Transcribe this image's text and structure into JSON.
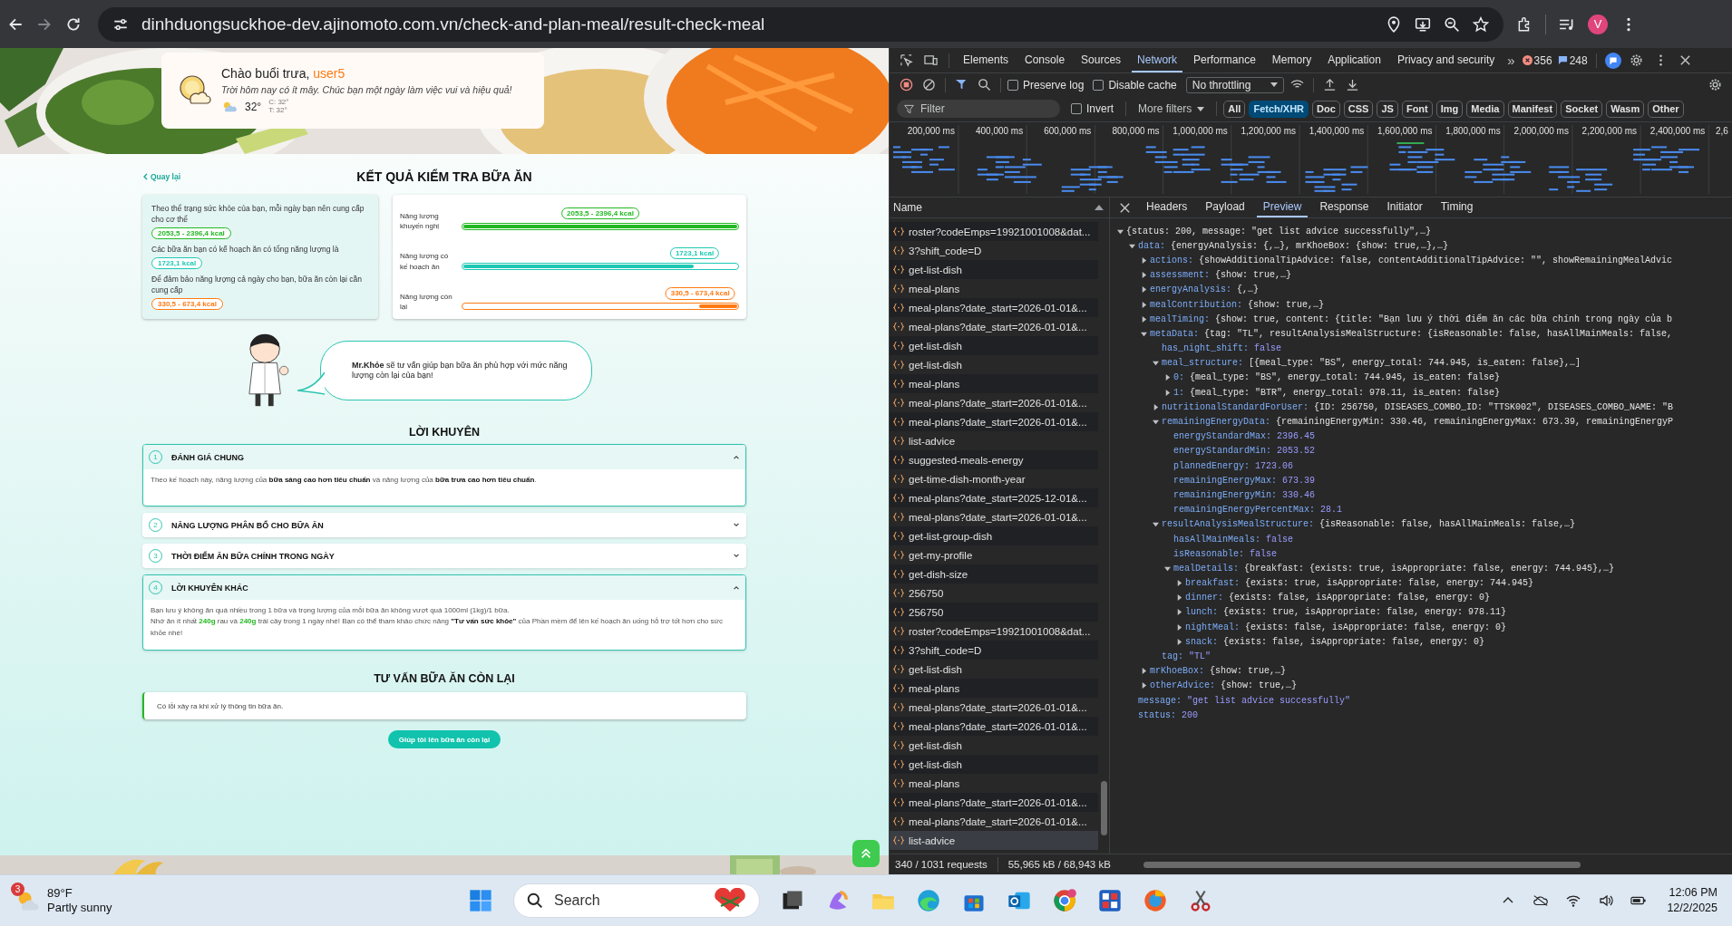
{
  "browser": {
    "url": "dinhduongsuckhoe-dev.ajinomoto.com.vn/check-and-plan-meal/result-check-meal",
    "profile_initial": "V"
  },
  "page": {
    "greeting": {
      "salutation": "Chào buổi trưa, ",
      "user": "user5",
      "message": "Trời hôm nay có ít mây. Chúc bạn một ngày làm việc vui và hiệu quả!",
      "temperature": "32°",
      "high": "C: 32°",
      "low": "T: 32°"
    },
    "back_link": "Quay lại",
    "title": "KẾT QUẢ KIỂM TRA BỮA ĂN",
    "summary": [
      {
        "text": "Theo thể trạng sức khỏe của bạn, mỗi ngày bạn nên cung cấp cho cơ thể",
        "badge": "2053,5 - 2396,4 kcal",
        "color": "#22b822"
      },
      {
        "text": "Các bữa ăn bạn có kế hoạch ăn có tổng năng lượng là",
        "badge": "1723,1 kcal",
        "color": "#1ec8b4"
      },
      {
        "text": "Để đảm bảo năng lượng cả ngày cho bạn, bữa ăn còn lại cần cung cấp",
        "badge": "330,5 - 673,4 kcal",
        "color": "#ff7a12"
      }
    ],
    "meters": [
      {
        "label": "Năng lượng khuyến nghị",
        "badge": "2053,5 - 2396,4 kcal",
        "level": 1,
        "color": "#22b822"
      },
      {
        "label": "Năng lượng có kế hoạch ăn",
        "badge": "1723,1 kcal",
        "level": 0.84,
        "from_end": false,
        "color": "#1ec8b4"
      },
      {
        "label": "Năng lượng còn lại",
        "badge": "330,5 - 673,4 kcal",
        "level": 0.14,
        "from_end": true,
        "color": "#ff7a12"
      }
    ],
    "mr_khoe": "**Mr.Khỏe** sẽ tư vấn giúp bạn bữa ăn phù hợp với mức năng lượng còn lại của bạn!",
    "advice_title": "LỜI KHUYÊN",
    "advice": [
      {
        "number": "1",
        "title": "ĐÁNH GIÁ CHUNG",
        "expanded": true,
        "paragraphs": [
          [
            {
              "text": "Theo kế hoạch này, năng lượng của ",
              "kind": "plain"
            },
            {
              "text": "bữa sáng cao hơn tiêu chuẩn",
              "kind": "bold"
            },
            {
              "text": " và năng lượng của ",
              "kind": "plain"
            },
            {
              "text": "bữa trưa cao hơn tiêu chuẩn",
              "kind": "bold"
            },
            {
              "text": ".",
              "kind": "plain"
            }
          ]
        ]
      },
      {
        "number": "2",
        "title": "NĂNG LƯỢNG PHÂN BỔ CHO BỮA ĂN",
        "expanded": false
      },
      {
        "number": "3",
        "title": "THỜI ĐIỂM ĂN BỮA CHÍNH TRONG NGÀY",
        "expanded": false
      },
      {
        "number": "4",
        "title": "LỜI KHUYÊN KHÁC",
        "expanded": true,
        "paragraphs": [
          [
            {
              "text": "Bạn lưu ý không ăn quá nhiều trong 1 bữa và trọng lượng của mỗi bữa ăn không vượt quá 1000ml (1kg)/1 bữa.",
              "kind": "plain"
            }
          ],
          [
            {
              "text": "Nhớ ăn ít nhất ",
              "kind": "plain"
            },
            {
              "text": "240g",
              "kind": "highlight"
            },
            {
              "text": " rau và ",
              "kind": "plain"
            },
            {
              "text": "240g",
              "kind": "highlight"
            },
            {
              "text": " trái cây trong 1 ngày nhé! Bạn có thể tham khảo chức năng ",
              "kind": "plain"
            },
            {
              "text": "\"Tư vấn sức khỏe\"",
              "kind": "bold"
            },
            {
              "text": " của Phần mềm để lên kế hoạch ăn uống hỗ trợ tốt hơn cho sức khỏe nhé!",
              "kind": "plain"
            }
          ]
        ]
      }
    ],
    "remaining_title": "TƯ VẤN BỮA ĂN CÒN LẠI",
    "remaining_message": "Có lỗi xảy ra khi xử lý thông tin bữa ăn.",
    "help_button": "Giúp tôi lên bữa ăn còn lại"
  },
  "devtools": {
    "tabs": [
      {
        "label": "Elements",
        "selected": false
      },
      {
        "label": "Console",
        "selected": false
      },
      {
        "label": "Sources",
        "selected": false
      },
      {
        "label": "Network",
        "selected": true
      },
      {
        "label": "Performance",
        "selected": false
      },
      {
        "label": "Memory",
        "selected": false
      },
      {
        "label": "Application",
        "selected": false
      },
      {
        "label": "Privacy and security",
        "selected": false
      }
    ],
    "more_tabs": "»",
    "errors": "356",
    "messages": "248",
    "preserve_log": {
      "label": "Preserve log",
      "checked": false
    },
    "disable_cache": {
      "label": "Disable cache",
      "checked": false
    },
    "throttling": "No throttling",
    "filter_placeholder": "Filter",
    "invert": {
      "label": "Invert",
      "checked": false
    },
    "more_filters": "More filters",
    "types": [
      {
        "label": "All",
        "selected": false
      },
      {
        "label": "Fetch/XHR",
        "selected": true
      },
      {
        "label": "Doc",
        "selected": false
      },
      {
        "label": "CSS",
        "selected": false
      },
      {
        "label": "JS",
        "selected": false
      },
      {
        "label": "Font",
        "selected": false
      },
      {
        "label": "Img",
        "selected": false
      },
      {
        "label": "Media",
        "selected": false
      },
      {
        "label": "Manifest",
        "selected": false
      },
      {
        "label": "Socket",
        "selected": false
      },
      {
        "label": "Wasm",
        "selected": false
      },
      {
        "label": "Other",
        "selected": false
      }
    ],
    "ticks": [
      "200,000 ms",
      "400,000 ms",
      "600,000 ms",
      "800,000 ms",
      "1,000,000 ms",
      "1,200,000 ms",
      "1,400,000 ms",
      "1,600,000 ms",
      "1,800,000 ms",
      "2,000,000 ms",
      "2,200,000 ms",
      "2,400,000 ms",
      "2,6"
    ],
    "name_header": "Name",
    "requests": [
      {
        "name": "roster?codeEmps=19921001008&dat...",
        "selected": false
      },
      {
        "name": "3?shift_code=D",
        "selected": false
      },
      {
        "name": "get-list-dish",
        "selected": false
      },
      {
        "name": "meal-plans",
        "selected": false
      },
      {
        "name": "meal-plans?date_start=2026-01-01&...",
        "selected": false
      },
      {
        "name": "meal-plans?date_start=2026-01-01&...",
        "selected": false
      },
      {
        "name": "get-list-dish",
        "selected": false
      },
      {
        "name": "get-list-dish",
        "selected": false
      },
      {
        "name": "meal-plans",
        "selected": false
      },
      {
        "name": "meal-plans?date_start=2026-01-01&...",
        "selected": false
      },
      {
        "name": "meal-plans?date_start=2026-01-01&...",
        "selected": false
      },
      {
        "name": "list-advice",
        "selected": false
      },
      {
        "name": "suggested-meals-energy",
        "selected": false
      },
      {
        "name": "get-time-dish-month-year",
        "selected": false
      },
      {
        "name": "meal-plans?date_start=2025-12-01&...",
        "selected": false
      },
      {
        "name": "meal-plans?date_start=2026-01-01&...",
        "selected": false
      },
      {
        "name": "get-list-group-dish",
        "selected": false
      },
      {
        "name": "get-my-profile",
        "selected": false
      },
      {
        "name": "get-dish-size",
        "selected": false
      },
      {
        "name": "256750",
        "selected": false
      },
      {
        "name": "256750",
        "selected": false
      },
      {
        "name": "roster?codeEmps=19921001008&dat...",
        "selected": false
      },
      {
        "name": "3?shift_code=D",
        "selected": false
      },
      {
        "name": "get-list-dish",
        "selected": false
      },
      {
        "name": "meal-plans",
        "selected": false
      },
      {
        "name": "meal-plans?date_start=2026-01-01&...",
        "selected": false
      },
      {
        "name": "meal-plans?date_start=2026-01-01&...",
        "selected": false
      },
      {
        "name": "get-list-dish",
        "selected": false
      },
      {
        "name": "get-list-dish",
        "selected": false
      },
      {
        "name": "meal-plans",
        "selected": false
      },
      {
        "name": "meal-plans?date_start=2026-01-01&...",
        "selected": false
      },
      {
        "name": "meal-plans?date_start=2026-01-01&...",
        "selected": false
      },
      {
        "name": "list-advice",
        "selected": true
      }
    ],
    "status": "340 / 1031 requests",
    "transfer": "55,965 kB / 68,943 kB",
    "detail_tabs": [
      {
        "label": "Headers",
        "selected": false
      },
      {
        "label": "Payload",
        "selected": false
      },
      {
        "label": "Preview",
        "selected": true
      },
      {
        "label": "Response",
        "selected": false
      },
      {
        "label": "Initiator",
        "selected": false
      },
      {
        "label": "Timing",
        "selected": false
      }
    ],
    "tree": {
      "value": "{status: 200, message: \"get list advice successfully\",…}",
      "expanded": true,
      "children": [
        {
          "key": "data:",
          "value": "{energyAnalysis: {,…}, mrKhoeBox: {show: true,…},…}",
          "expanded": true,
          "children": [
            {
              "key": "actions:",
              "value": "{showAdditionalTipAdvice: false, contentAdditionalTipAdvice: \"\", showRemainingMealAdvic",
              "expanded": false
            },
            {
              "key": "assessment:",
              "value": "{show: true,…}",
              "expanded": false
            },
            {
              "key": "energyAnalysis:",
              "value": "{,…}",
              "expanded": false
            },
            {
              "key": "mealContribution:",
              "value": "{show: true,…}",
              "expanded": false
            },
            {
              "key": "mealTiming:",
              "value": "{show: true, content: {title: \"Bạn lưu ý thời điểm ăn các bữa chính trong ngày của b",
              "expanded": false
            },
            {
              "key": "metaData:",
              "value": "{tag: \"TL\", resultAnalysisMealStructure: {isReasonable: false, hasAllMainMeals: false,",
              "expanded": true,
              "children": [
                {
                  "key": "has_night_shift:",
                  "value": "false"
                },
                {
                  "key": "meal_structure:",
                  "value": "[{meal_type: \"BS\", energy_total: 744.945, is_eaten: false},…]",
                  "expanded": true,
                  "children": [
                    {
                      "key": "0:",
                      "value": "{meal_type: \"BS\", energy_total: 744.945, is_eaten: false}",
                      "expanded": false
                    },
                    {
                      "key": "1:",
                      "value": "{meal_type: \"BTR\", energy_total: 978.11, is_eaten: false}",
                      "expanded": false
                    }
                  ]
                },
                {
                  "key": "nutritionalStandardForUser:",
                  "value": "{ID: 256750, DISEASES_COMBO_ID: \"TTSK002\", DISEASES_COMBO_NAME: \"B",
                  "expanded": false
                },
                {
                  "key": "remainingEnergyData:",
                  "value": "{remainingEnergyMin: 330.46, remainingEnergyMax: 673.39, remainingEnergyP",
                  "expanded": true,
                  "children": [
                    {
                      "key": "energyStandardMax:",
                      "value": "2396.45"
                    },
                    {
                      "key": "energyStandardMin:",
                      "value": "2053.52"
                    },
                    {
                      "key": "plannedEnergy:",
                      "value": "1723.06"
                    },
                    {
                      "key": "remainingEnergyMax:",
                      "value": "673.39"
                    },
                    {
                      "key": "remainingEnergyMin:",
                      "value": "330.46"
                    },
                    {
                      "key": "remainingEnergyPercentMax:",
                      "value": "28.1"
                    }
                  ]
                },
                {
                  "key": "resultAnalysisMealStructure:",
                  "value": "{isReasonable: false, hasAllMainMeals: false,…}",
                  "expanded": true,
                  "children": [
                    {
                      "key": "hasAllMainMeals:",
                      "value": "false"
                    },
                    {
                      "key": "isReasonable:",
                      "value": "false"
                    },
                    {
                      "key": "mealDetails:",
                      "value": "{breakfast: {exists: true, isAppropriate: false, energy: 744.945},…}",
                      "expanded": true,
                      "children": [
                        {
                          "key": "breakfast:",
                          "value": "{exists: true, isAppropriate: false, energy: 744.945}",
                          "expanded": false
                        },
                        {
                          "key": "dinner:",
                          "value": "{exists: false, isAppropriate: false, energy: 0}",
                          "expanded": false
                        },
                        {
                          "key": "lunch:",
                          "value": "{exists: true, isAppropriate: false, energy: 978.11}",
                          "expanded": false
                        },
                        {
                          "key": "nightMeal:",
                          "value": "{exists: false, isAppropriate: false, energy: 0}",
                          "expanded": false
                        },
                        {
                          "key": "snack:",
                          "value": "{exists: false, isAppropriate: false, energy: 0}",
                          "expanded": false
                        }
                      ]
                    }
                  ]
                },
                {
                  "key": "tag:",
                  "value": "\"TL\""
                }
              ]
            },
            {
              "key": "mrKhoeBox:",
              "value": "{show: true,…}",
              "expanded": false
            },
            {
              "key": "otherAdvice:",
              "value": "{show: true,…}",
              "expanded": false
            }
          ]
        },
        {
          "key": "message:",
          "value": "\"get list advice successfully\""
        },
        {
          "key": "status:",
          "value": "200"
        }
      ]
    }
  },
  "taskbar": {
    "weather_badge": "3",
    "temperature": "89°F",
    "condition": "Partly sunny",
    "search": "Search",
    "time": "12:06 PM",
    "date": "12/2/2025"
  }
}
